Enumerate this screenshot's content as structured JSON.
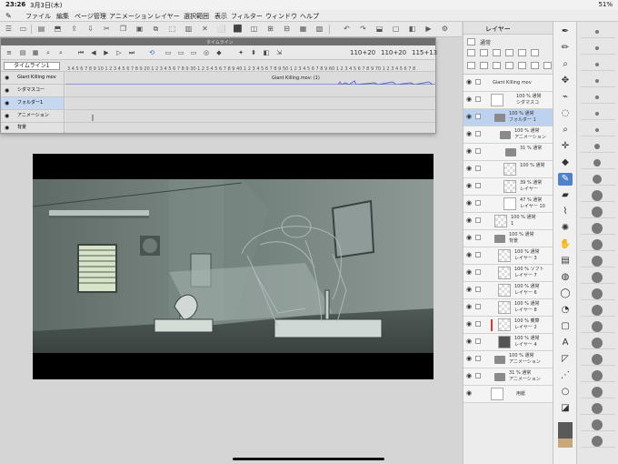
{
  "status": {
    "time": "23:26",
    "date": "3月3日(木)",
    "battery": "51%"
  },
  "menu": {
    "items": [
      "ファイル",
      "編集",
      "ページ管理",
      "アニメーション",
      "レイヤー",
      "選択範囲",
      "表示",
      "フィルター",
      "ウィンドウ",
      "ヘルプ"
    ]
  },
  "timeline": {
    "panel_title": "タイムライン",
    "timeline_name": "タイムライン1",
    "frame_a": "110+20",
    "frame_b": "110+20",
    "frame_c": "115+13",
    "ruler_digits": "3 4 5 6 7 8 9 10 1 2 3 4 5 6 7 8 9 20 1 2 3 4 5 6 7 8 9 30 1 2 3 4 5 6 7 8 9 40 1 2 3 4 5 6 7 8 9 50 1 2 3 4 5 6 7 8 9 60 1 2 3 4 5 6 7 8 9 70 1 2 3 4 5 6 7 8",
    "audio_clip": "Giant Killing.mov: (1)",
    "tracks": [
      {
        "label": "Giant Killing mov"
      },
      {
        "label": "シダマスコー"
      },
      {
        "label": "フォルダー1"
      },
      {
        "label": "アニメーション"
      },
      {
        "label": "背景"
      }
    ]
  },
  "layers": {
    "header": "レイヤー",
    "blend_label": "通常",
    "items": [
      {
        "line1": "Giant Killing mov",
        "line2": ""
      },
      {
        "line1": "100 % 通常",
        "line2": "シダマスコ"
      },
      {
        "line1": "100 % 通常",
        "line2": "フォルダー 1"
      },
      {
        "line1": "100 % 通常",
        "line2": "アニメーション"
      },
      {
        "line1": "31 % 通常",
        "line2": ""
      },
      {
        "line1": "100 % 通常",
        "line2": ""
      },
      {
        "line1": "39 % 通常",
        "line2": "レイヤー"
      },
      {
        "line1": "47 % 通常",
        "line2": "レイヤー 10"
      },
      {
        "line1": "100 % 通常",
        "line2": "1"
      },
      {
        "line1": "100 % 通常",
        "line2": "背景"
      },
      {
        "line1": "100 % 通常",
        "line2": "レイヤー 3"
      },
      {
        "line1": "100 % ソフト",
        "line2": "レイヤー 7"
      },
      {
        "line1": "100 % 通常",
        "line2": "レイヤー 6"
      },
      {
        "line1": "100 % 通常",
        "line2": "レイヤー 8"
      },
      {
        "line1": "100 % 乗算",
        "line2": "レイヤー 2"
      },
      {
        "line1": "100 % 通常",
        "line2": "レイヤー 4"
      },
      {
        "line1": "100 % 通常",
        "line2": "アニメーション"
      },
      {
        "line1": "31 % 通常",
        "line2": "アニメーション"
      },
      {
        "line1": "用紙",
        "line2": ""
      }
    ]
  },
  "colors": {
    "selection": "#bcd2ee",
    "accent": "#4f82c8"
  }
}
